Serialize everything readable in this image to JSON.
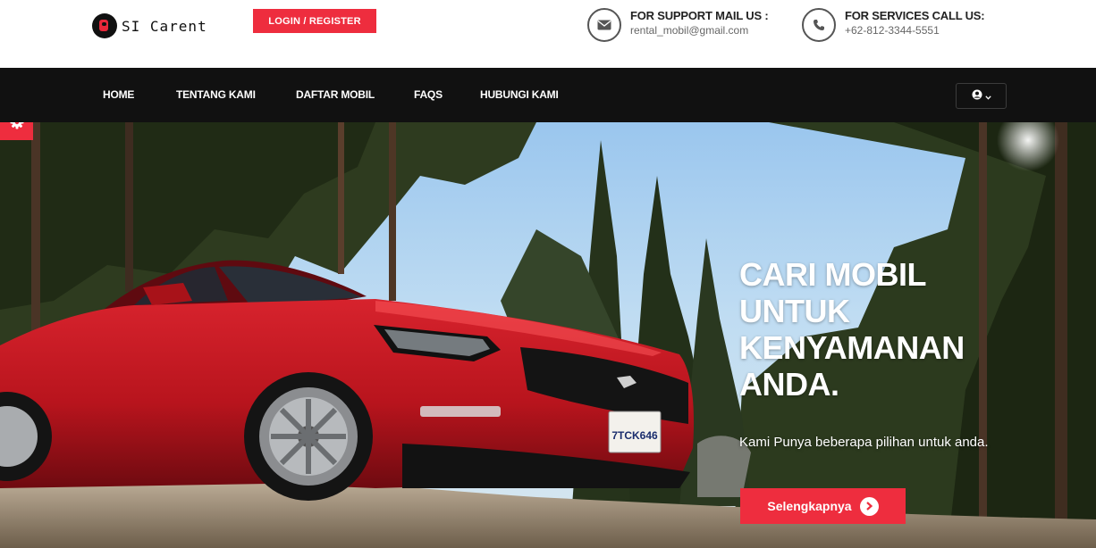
{
  "brand": {
    "name": "SI Carent",
    "logo_icon": "car-logo-icon"
  },
  "header": {
    "login_label": "LOGIN / REGISTER",
    "support": {
      "title": "FOR SUPPORT MAIL US :",
      "value": "rental_mobil@gmail.com",
      "icon": "mail-icon"
    },
    "services": {
      "title": "FOR SERVICES CALL US:",
      "value": "+62-812-3344-5551",
      "icon": "phone-icon"
    }
  },
  "nav": {
    "items": [
      {
        "label": "HOME"
      },
      {
        "label": "TENTANG KAMI"
      },
      {
        "label": "DAFTAR MOBIL"
      },
      {
        "label": "FAQS"
      },
      {
        "label": "HUBUNGI KAMI"
      }
    ],
    "user_icon": "user-icon",
    "dropdown_icon": "chevron-down-icon"
  },
  "hero": {
    "title": "CARI MOBIL UNTUK KENYAMANAN ANDA.",
    "subtitle": "Kami Punya beberapa pilihan untuk anda.",
    "cta_label": "Selengkapnya",
    "cta_icon": "arrow-right-circle-icon",
    "plate": "7TCK646",
    "image": "red-car-forest-photo"
  },
  "settings_icon": "gear-icon",
  "colors": {
    "accent": "#ee2d3e",
    "nav_bg": "#111111",
    "text_dark": "#222222"
  }
}
